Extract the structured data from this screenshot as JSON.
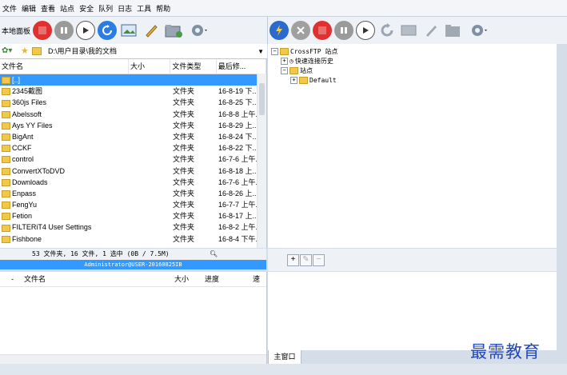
{
  "menu": [
    "文件",
    "编辑",
    "查看",
    "站点",
    "安全",
    "队列",
    "日志",
    "工具",
    "帮助"
  ],
  "left_toolbar": {
    "panel_label": "本地面板"
  },
  "path": {
    "value": "D:\\用户目录\\我的文档"
  },
  "file_columns": [
    "文件名",
    "大小",
    "文件类型",
    "最后修..."
  ],
  "files": [
    {
      "name": "[..]",
      "size": "",
      "type": "",
      "modified": "",
      "selected": true
    },
    {
      "name": "2345截图",
      "size": "",
      "type": "文件夹",
      "modified": "16-8-19 下..."
    },
    {
      "name": "360js Files",
      "size": "",
      "type": "文件夹",
      "modified": "16-8-25 下..."
    },
    {
      "name": "Abelssoft",
      "size": "",
      "type": "文件夹",
      "modified": "16-8-8 上午..."
    },
    {
      "name": "Ays YY Files",
      "size": "",
      "type": "文件夹",
      "modified": "16-8-29 上..."
    },
    {
      "name": "BigAnt",
      "size": "",
      "type": "文件夹",
      "modified": "16-8-24 下..."
    },
    {
      "name": "CCKF",
      "size": "",
      "type": "文件夹",
      "modified": "16-8-22 下..."
    },
    {
      "name": "control",
      "size": "",
      "type": "文件夹",
      "modified": "16-7-6 上午..."
    },
    {
      "name": "ConvertXToDVD",
      "size": "",
      "type": "文件夹",
      "modified": "16-8-18 上..."
    },
    {
      "name": "Downloads",
      "size": "",
      "type": "文件夹",
      "modified": "16-7-6 上午..."
    },
    {
      "name": "Enpass",
      "size": "",
      "type": "文件夹",
      "modified": "16-8-26 上..."
    },
    {
      "name": "FengYu",
      "size": "",
      "type": "文件夹",
      "modified": "16-7-7 上午..."
    },
    {
      "name": "Fetion",
      "size": "",
      "type": "文件夹",
      "modified": "16-8-17 上..."
    },
    {
      "name": "FILTERiT4 User Settings",
      "size": "",
      "type": "文件夹",
      "modified": "16-8-2 上午..."
    },
    {
      "name": "Fishbone",
      "size": "",
      "type": "文件夹",
      "modified": "16-8-4 下午..."
    }
  ],
  "status": {
    "summary": "53 文件夹, 16 文件, 1 选中 (0B / 7.5M)",
    "host": "Administrator@USER-20160825IB"
  },
  "tree": {
    "root": "CrossFTP 站点",
    "quick": "快速连接历史",
    "sites": "站点",
    "default": "Default"
  },
  "queue_columns": [
    "-",
    "文件名",
    "大小",
    "进度",
    "速"
  ],
  "log_tab": "主窗口",
  "watermark": "最需教育",
  "colors": {
    "selection": "#3399ff",
    "stop": "#e03030",
    "accent": "#2a7de1"
  }
}
